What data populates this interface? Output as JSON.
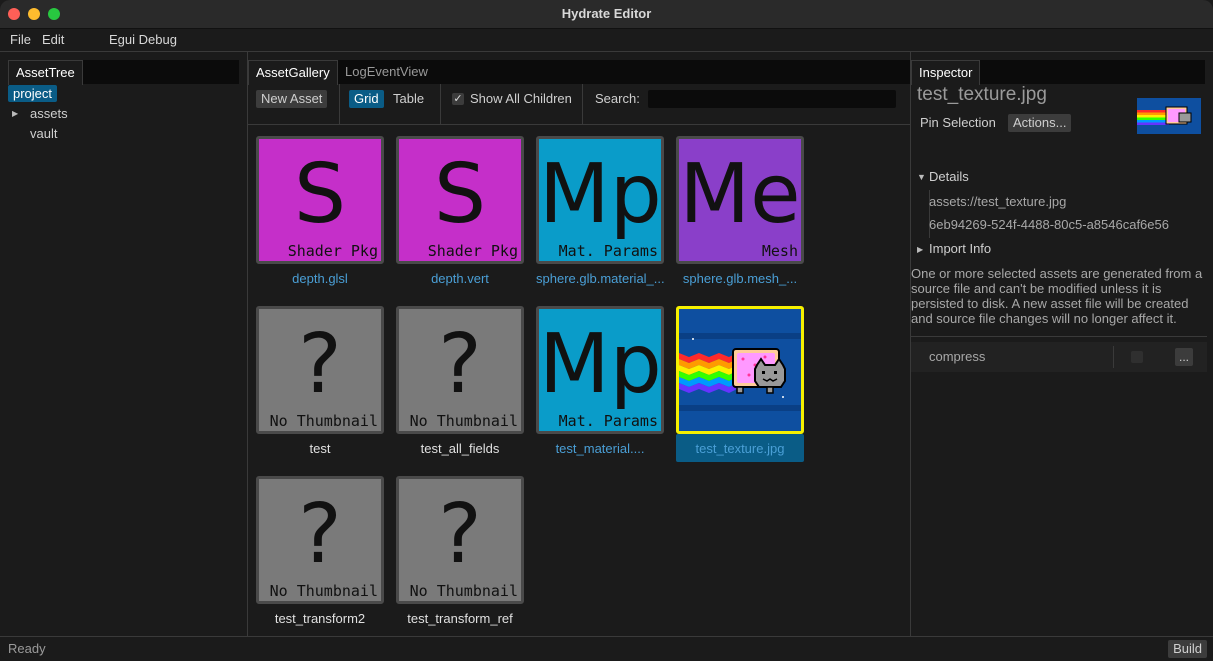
{
  "window": {
    "title": "Hydrate Editor"
  },
  "menu": {
    "file": "File",
    "edit": "Edit",
    "egui_debug": "Egui Debug"
  },
  "asset_tree": {
    "tab": "AssetTree",
    "items": [
      {
        "label": "project",
        "selected": true
      },
      {
        "label": "assets",
        "expandable": true
      },
      {
        "label": "vault"
      }
    ]
  },
  "gallery": {
    "tabs": [
      "AssetGallery",
      "LogEventView"
    ],
    "toolbar": {
      "new_asset": "New Asset",
      "grid": "Grid",
      "table": "Table",
      "show_all_children": "Show All Children",
      "show_all_children_checked": true,
      "search_label": "Search:",
      "search_value": ""
    },
    "tiles": [
      {
        "glyph": "S",
        "type": "Shader Pkg",
        "name": "depth.glsl",
        "color": "#c52fc9"
      },
      {
        "glyph": "S",
        "type": "Shader Pkg",
        "name": "depth.vert",
        "color": "#c52fc9"
      },
      {
        "glyph": "Mp",
        "type": "Mat. Params",
        "name": "sphere.glb.material_...",
        "color": "#0a9cc9"
      },
      {
        "glyph": "Me",
        "type": "Mesh",
        "name": "sphere.glb.mesh_...",
        "color": "#8a3fc9"
      },
      {
        "glyph": "?",
        "type": "No Thumbnail",
        "name": "test",
        "color": "#7a7a7a"
      },
      {
        "glyph": "?",
        "type": "No Thumbnail",
        "name": "test_all_fields",
        "color": "#7a7a7a"
      },
      {
        "glyph": "Mp",
        "type": "Mat. Params",
        "name": "test_material....",
        "color": "#0a9cc9"
      },
      {
        "glyph": "",
        "type": "",
        "name": "test_texture.jpg",
        "color": "#0e4fa0",
        "selected": true
      },
      {
        "glyph": "?",
        "type": "No Thumbnail",
        "name": "test_transform2",
        "color": "#7a7a7a"
      },
      {
        "glyph": "?",
        "type": "No Thumbnail",
        "name": "test_transform_ref",
        "color": "#7a7a7a"
      }
    ]
  },
  "inspector": {
    "tab": "Inspector",
    "title": "test_texture.jpg",
    "pin_selection": "Pin Selection",
    "actions": "Actions...",
    "details_header": "Details",
    "path": "assets://test_texture.jpg",
    "uuid": "6eb94269-524f-4488-80c5-a8546caf6e56",
    "import_info": "Import Info",
    "note": "One or more selected assets are generated from a source file and can't be modified unless it is persisted to disk. A new asset file will be created and source file changes will no longer affect it.",
    "property_name": "compress",
    "more_button": "..."
  },
  "status": {
    "text": "Ready",
    "build": "Build"
  }
}
